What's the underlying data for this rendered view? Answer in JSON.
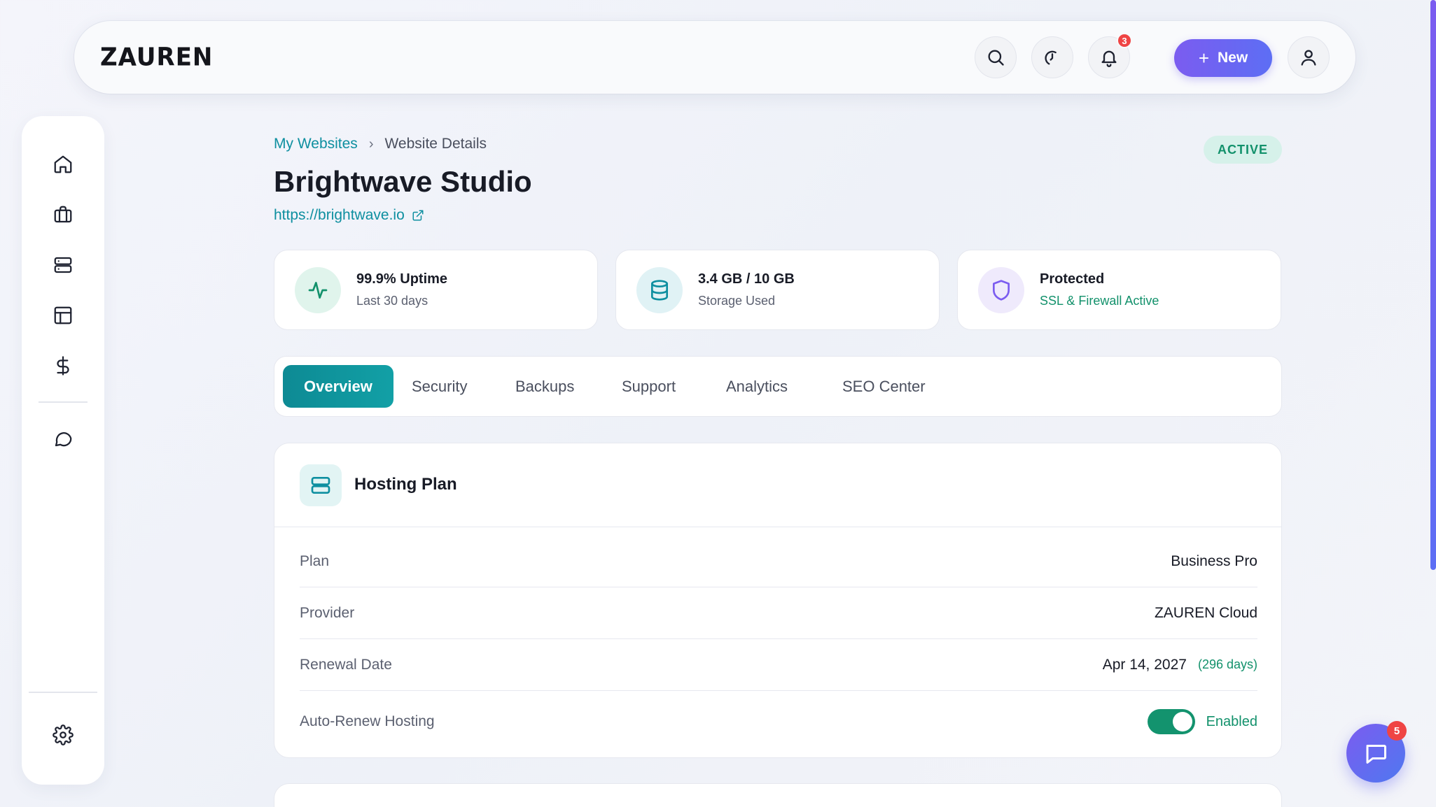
{
  "header": {
    "logo": "ZAUREN",
    "notifications_count": "3",
    "new_button_label": "New"
  },
  "sidebar": {
    "items": [
      "home-icon",
      "briefcase-icon",
      "server-icon",
      "layout-icon",
      "dollar-icon",
      "chat-icon"
    ],
    "settings": "gear-icon"
  },
  "breadcrumb": {
    "parent": "My Websites",
    "separator": "›",
    "current": "Website Details"
  },
  "site": {
    "name": "Brightwave Studio",
    "url": "https://brightwave.io",
    "status": "ACTIVE"
  },
  "stats": [
    {
      "title": "99.9% Uptime",
      "sub": "Last 30 days"
    },
    {
      "title": "3.4 GB / 10 GB",
      "sub": "Storage Used"
    },
    {
      "title": "Protected",
      "sub": "SSL & Firewall Active"
    }
  ],
  "tabs": [
    "Overview",
    "Security",
    "Backups",
    "Support",
    "Analytics",
    "SEO Center"
  ],
  "hosting": {
    "title": "Hosting Plan",
    "rows": [
      {
        "label": "Plan",
        "value": "Business Pro"
      },
      {
        "label": "Provider",
        "value": "ZAUREN Cloud"
      },
      {
        "label": "Renewal Date",
        "value": "Apr 14, 2027",
        "extra": "(296 days)"
      },
      {
        "label": "Auto-Renew Hosting",
        "value": "Enabled"
      }
    ]
  },
  "chat": {
    "badge": "5"
  },
  "colors": {
    "accent_teal": "#0e8fa0",
    "accent_purple": "#7b5cf0",
    "success": "#12916b",
    "danger": "#ef4444"
  }
}
